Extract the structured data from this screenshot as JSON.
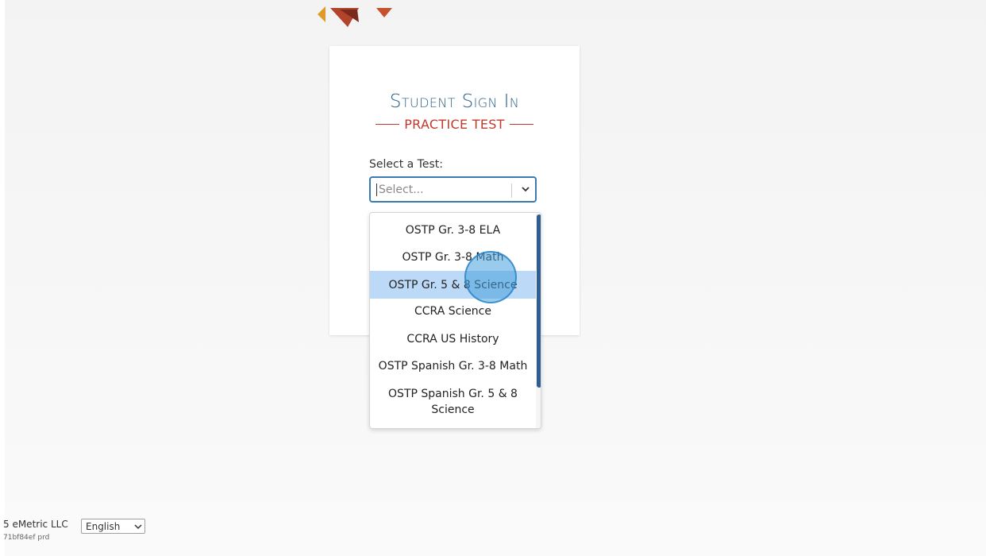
{
  "card": {
    "title": "Student Sign In",
    "subtitle": "PRACTICE TEST"
  },
  "select": {
    "label": "Select a Test:",
    "placeholder": "Select...",
    "options": [
      "OSTP Gr. 3-8 ELA",
      "OSTP Gr. 3-8 Math",
      "OSTP Gr. 5 & 8 Science",
      "CCRA Science",
      "CCRA US History",
      "OSTP Spanish Gr. 3-8 Math",
      "OSTP Spanish Gr. 5 & 8 Science"
    ],
    "highlighted_option": "OSTP Gr. 5 & 8 Science"
  },
  "footer": {
    "copyright": "5 eMetric LLC",
    "build": "71bf84ef  prd",
    "language": "English"
  },
  "colors": {
    "title_blue": "#2a5f86",
    "accent_red": "#c0392b",
    "highlight": "#bcd9f7",
    "scrollbar": "#2f5f92"
  },
  "icons": {
    "select_chevron": "chevron-down-icon",
    "logo": "logo-icon"
  }
}
